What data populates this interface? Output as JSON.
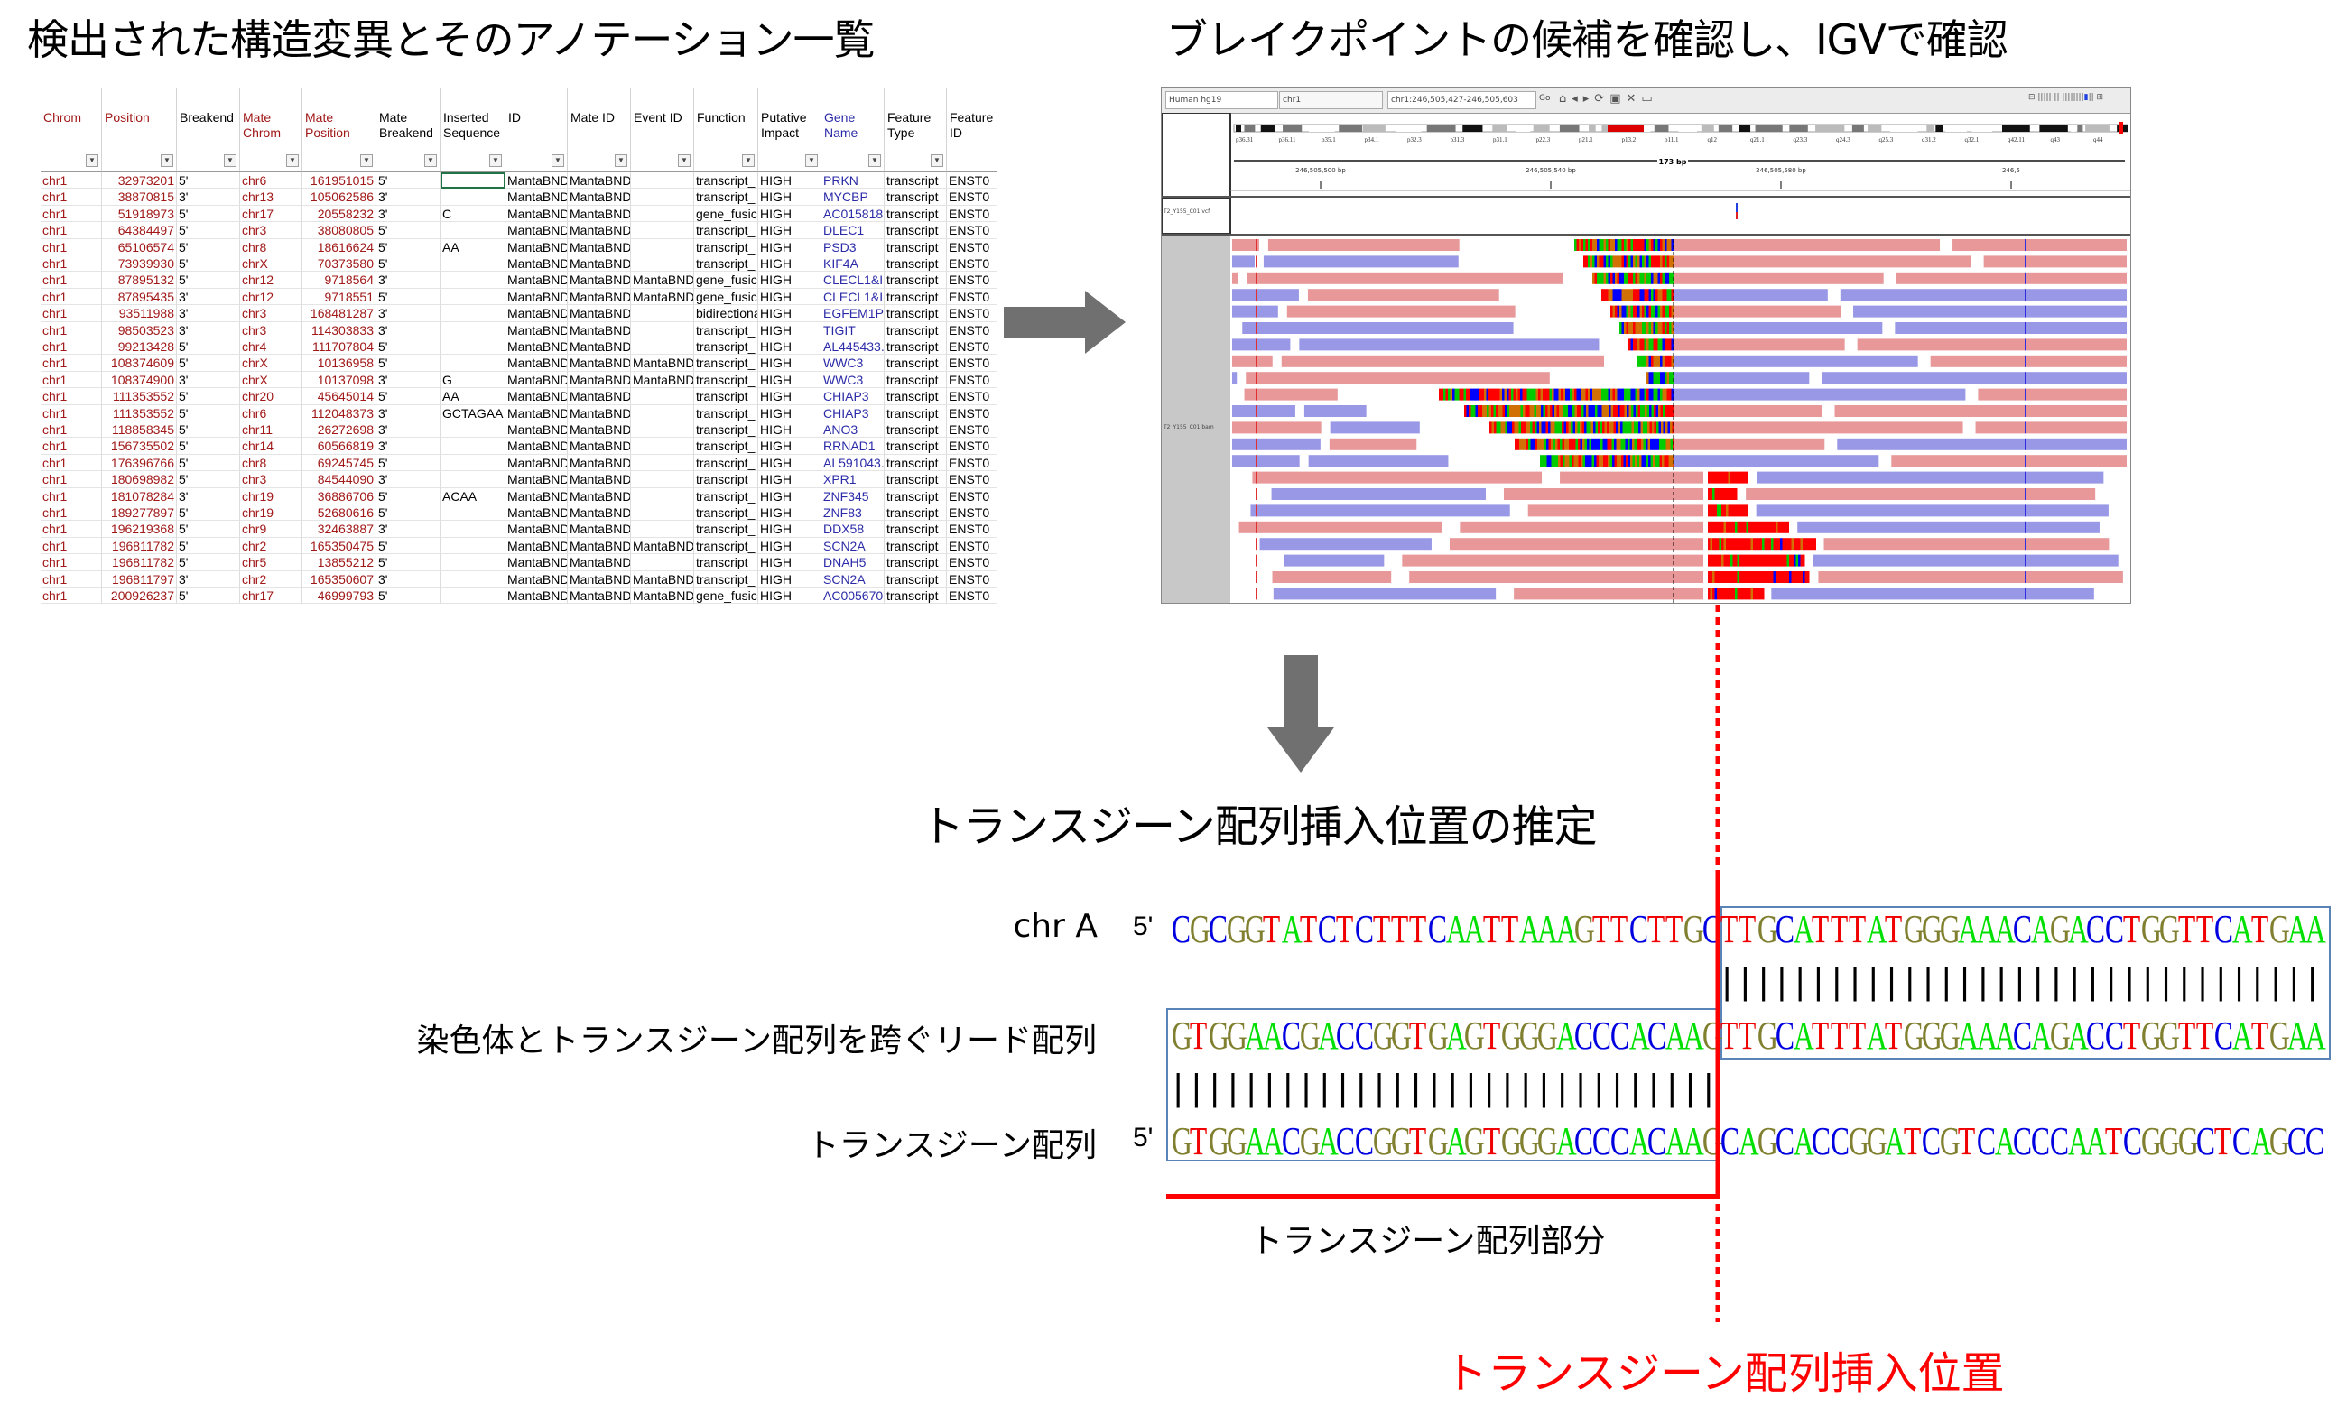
{
  "titles": {
    "left": "検出された構造変異とそのアノテーション一覧",
    "right": "ブレイクポイントの候補を確認し、IGVで確認",
    "middle": "トランスジーン配列挿入位置の推定"
  },
  "sheet": {
    "columns": [
      {
        "label": "Chrom",
        "color": "red"
      },
      {
        "label": "Position",
        "color": "red"
      },
      {
        "label": "Breakend",
        "color": "black"
      },
      {
        "label": "Mate Chrom",
        "color": "red"
      },
      {
        "label": "Mate Position",
        "color": "red"
      },
      {
        "label": "Mate Breakend",
        "color": "black"
      },
      {
        "label": "Inserted Sequence",
        "color": "black"
      },
      {
        "label": "ID",
        "color": "black"
      },
      {
        "label": "Mate ID",
        "color": "black"
      },
      {
        "label": "Event ID",
        "color": "black"
      },
      {
        "label": "Function",
        "color": "black"
      },
      {
        "label": "Putative Impact",
        "color": "black"
      },
      {
        "label": "Gene Name",
        "color": "blue"
      },
      {
        "label": "Feature Type",
        "color": "black"
      },
      {
        "label": "Feature ID",
        "color": "black"
      }
    ],
    "rows": [
      [
        "chr1",
        "32973201",
        "5'",
        "chr6",
        "161951015",
        "5'",
        "",
        "MantaBND",
        "MantaBND",
        "",
        "transcript_",
        "HIGH",
        "PRKN",
        "transcript",
        "ENST0"
      ],
      [
        "chr1",
        "38870815",
        "3'",
        "chr13",
        "105062586",
        "3'",
        "",
        "MantaBND",
        "MantaBND",
        "",
        "transcript_",
        "HIGH",
        "MYCBP",
        "transcript",
        "ENST0"
      ],
      [
        "chr1",
        "51918973",
        "5'",
        "chr17",
        "20558232",
        "3'",
        "C",
        "MantaBND",
        "MantaBND",
        "",
        "gene_fusic",
        "HIGH",
        "AC015818",
        "transcript",
        "ENST0"
      ],
      [
        "chr1",
        "64384497",
        "5'",
        "chr3",
        "38080805",
        "5'",
        "",
        "MantaBND",
        "MantaBND",
        "",
        "transcript_",
        "HIGH",
        "DLEC1",
        "transcript",
        "ENST0"
      ],
      [
        "chr1",
        "65106574",
        "5'",
        "chr8",
        "18616624",
        "5'",
        "AA",
        "MantaBND",
        "MantaBND",
        "",
        "transcript_",
        "HIGH",
        "PSD3",
        "transcript",
        "ENST0"
      ],
      [
        "chr1",
        "73939930",
        "5'",
        "chrX",
        "70373580",
        "5'",
        "",
        "MantaBND",
        "MantaBND",
        "",
        "transcript_",
        "HIGH",
        "KIF4A",
        "transcript",
        "ENST0"
      ],
      [
        "chr1",
        "87895132",
        "5'",
        "chr12",
        "9718564",
        "3'",
        "",
        "MantaBND",
        "MantaBND",
        "MantaBND",
        "gene_fusic",
        "HIGH",
        "CLECL1&I",
        "transcript",
        "ENST0"
      ],
      [
        "chr1",
        "87895435",
        "3'",
        "chr12",
        "9718551",
        "5'",
        "",
        "MantaBND",
        "MantaBND",
        "MantaBND",
        "gene_fusic",
        "HIGH",
        "CLECL1&I",
        "transcript",
        "ENST0"
      ],
      [
        "chr1",
        "93511988",
        "3'",
        "chr3",
        "168481287",
        "3'",
        "",
        "MantaBND",
        "MantaBND",
        "",
        "bidirectiona",
        "HIGH",
        "EGFEM1P",
        "transcript",
        "ENST0"
      ],
      [
        "chr1",
        "98503523",
        "3'",
        "chr3",
        "114303833",
        "3'",
        "",
        "MantaBND",
        "MantaBND",
        "",
        "transcript_",
        "HIGH",
        "TIGIT",
        "transcript",
        "ENST0"
      ],
      [
        "chr1",
        "99213428",
        "5'",
        "chr4",
        "111707804",
        "5'",
        "",
        "MantaBND",
        "MantaBND",
        "",
        "transcript_",
        "HIGH",
        "AL445433.",
        "transcript",
        "ENST0"
      ],
      [
        "chr1",
        "108374609",
        "5'",
        "chrX",
        "10136958",
        "5'",
        "",
        "MantaBND",
        "MantaBND",
        "MantaBND",
        "transcript_",
        "HIGH",
        "WWC3",
        "transcript",
        "ENST0"
      ],
      [
        "chr1",
        "108374900",
        "3'",
        "chrX",
        "10137098",
        "3'",
        "G",
        "MantaBND",
        "MantaBND",
        "MantaBND",
        "transcript_",
        "HIGH",
        "WWC3",
        "transcript",
        "ENST0"
      ],
      [
        "chr1",
        "111353552",
        "5'",
        "chr20",
        "45645014",
        "5'",
        "AA",
        "MantaBND",
        "MantaBND",
        "",
        "transcript_",
        "HIGH",
        "CHIAP3",
        "transcript",
        "ENST0"
      ],
      [
        "chr1",
        "111353552",
        "5'",
        "chr6",
        "112048373",
        "3'",
        "GCTAGAA",
        "MantaBND",
        "MantaBND",
        "",
        "transcript_",
        "HIGH",
        "CHIAP3",
        "transcript",
        "ENST0"
      ],
      [
        "chr1",
        "118858345",
        "5'",
        "chr11",
        "26272698",
        "3'",
        "",
        "MantaBND",
        "MantaBND",
        "",
        "transcript_",
        "HIGH",
        "ANO3",
        "transcript",
        "ENST0"
      ],
      [
        "chr1",
        "156735502",
        "5'",
        "chr14",
        "60566819",
        "3'",
        "",
        "MantaBND",
        "MantaBND",
        "",
        "transcript_",
        "HIGH",
        "RRNAD1",
        "transcript",
        "ENST0"
      ],
      [
        "chr1",
        "176396766",
        "5'",
        "chr8",
        "69245745",
        "5'",
        "",
        "MantaBND",
        "MantaBND",
        "",
        "transcript_",
        "HIGH",
        "AL591043.",
        "transcript",
        "ENST0"
      ],
      [
        "chr1",
        "180698982",
        "5'",
        "chr3",
        "84544090",
        "3'",
        "",
        "MantaBND",
        "MantaBND",
        "",
        "transcript_",
        "HIGH",
        "XPR1",
        "transcript",
        "ENST0"
      ],
      [
        "chr1",
        "181078284",
        "3'",
        "chr19",
        "36886706",
        "5'",
        "ACAA",
        "MantaBND",
        "MantaBND",
        "",
        "transcript_",
        "HIGH",
        "ZNF345",
        "transcript",
        "ENST0"
      ],
      [
        "chr1",
        "189277897",
        "5'",
        "chr19",
        "52680616",
        "5'",
        "",
        "MantaBND",
        "MantaBND",
        "",
        "transcript_",
        "HIGH",
        "ZNF83",
        "transcript",
        "ENST0"
      ],
      [
        "chr1",
        "196219368",
        "5'",
        "chr9",
        "32463887",
        "3'",
        "",
        "MantaBND",
        "MantaBND",
        "",
        "transcript_",
        "HIGH",
        "DDX58",
        "transcript",
        "ENST0"
      ],
      [
        "chr1",
        "196811782",
        "5'",
        "chr2",
        "165350475",
        "5'",
        "",
        "MantaBND",
        "MantaBND",
        "MantaBND",
        "transcript_",
        "HIGH",
        "SCN2A",
        "transcript",
        "ENST0"
      ],
      [
        "chr1",
        "196811782",
        "5'",
        "chr5",
        "13855212",
        "5'",
        "",
        "MantaBND",
        "MantaBND",
        "",
        "transcript_",
        "HIGH",
        "DNAH5",
        "transcript",
        "ENST0"
      ],
      [
        "chr1",
        "196811797",
        "3'",
        "chr2",
        "165350607",
        "3'",
        "",
        "MantaBND",
        "MantaBND",
        "MantaBND",
        "transcript_",
        "HIGH",
        "SCN2A",
        "transcript",
        "ENST0"
      ],
      [
        "chr1",
        "200926237",
        "5'",
        "chr17",
        "46999793",
        "5'",
        "",
        "MantaBND",
        "MantaBND",
        "MantaBND",
        "gene_fusic",
        "HIGH",
        "AC005670",
        "transcript",
        "ENST0"
      ]
    ]
  },
  "igv": {
    "genome": "Human hg19",
    "chromosome": "chr1",
    "locus": "chr1:246,505,427-246,505,603",
    "go_label": "Go",
    "span": "173 bp",
    "ruler_ticks": [
      "246,505,500 bp",
      "246,505,540 bp",
      "246,505,580 bp",
      "246,5"
    ],
    "bands": [
      "p36.31",
      "p36.11",
      "p35.1",
      "p34.1",
      "p32.3",
      "p31.3",
      "p31.1",
      "p22.3",
      "p21.1",
      "p13.2",
      "p11.1",
      "q12",
      "q21.1",
      "q23.3",
      "q24.3",
      "q25.3",
      "q31.2",
      "q32.1",
      "q42.11",
      "q43",
      "q44"
    ],
    "track_name": "T2_Y155_C01.vcf",
    "alignment_track_name": "T2_Y155_C01.bam",
    "colors": {
      "forward": "#e89898",
      "reverse": "#9898e6",
      "A": "#00cc00",
      "C": "#0000ff",
      "G": "#d17105",
      "T": "#ff0000"
    }
  },
  "alignment": {
    "chr_label": "chr A",
    "read_label": "染色体とトランスジーン配列を跨ぐリード配列",
    "transgene_label": "トランスジーン配列",
    "five_prime": "5'",
    "chr_seq": "CGCGGTATCTCTTTCAATTAAAGTTCTTGCTTGCATTTATGGGAAACAGACCTGGTTCATGAA",
    "read_seq": "GTGGAACGACCGGTGAGTGGGACCCACAAGTTGCATTTATGGGAAACAGACCTGGTTCATGAA",
    "transgene_seq": "GTGGAACGACCGGTGAGTGGGACCCACAAGCAGCACCGGATCGTCACCCAATCGGGCTCAGCC",
    "match_bars_upper": "|||||||||||||||||||||||||||||||||",
    "match_bars_lower": "||||||||||||||||||||||||||||||",
    "transgene_part_label": "トランスジーン配列部分",
    "insertion_site_label": "トランスジーン配列挿入位置",
    "base_colors": {
      "A": "#00e000",
      "C": "#0000e0",
      "G": "#808030",
      "T": "#f00000"
    },
    "highlight_color": "#ff0000"
  }
}
